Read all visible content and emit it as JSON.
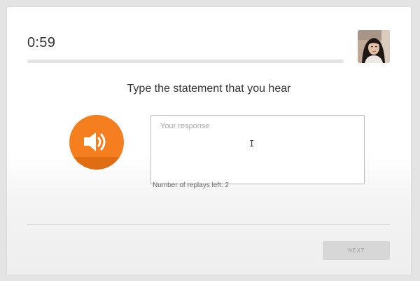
{
  "timer": {
    "value": "0:59",
    "progress": 0
  },
  "prompt": {
    "title": "Type the statement that you hear"
  },
  "audio": {
    "icon": "speaker-volume-icon",
    "color": "#f57f1f"
  },
  "response": {
    "placeholder": "Your response",
    "value": ""
  },
  "replays": {
    "text": "Number of replays left: 2"
  },
  "footer": {
    "next_label": "NEXT"
  }
}
